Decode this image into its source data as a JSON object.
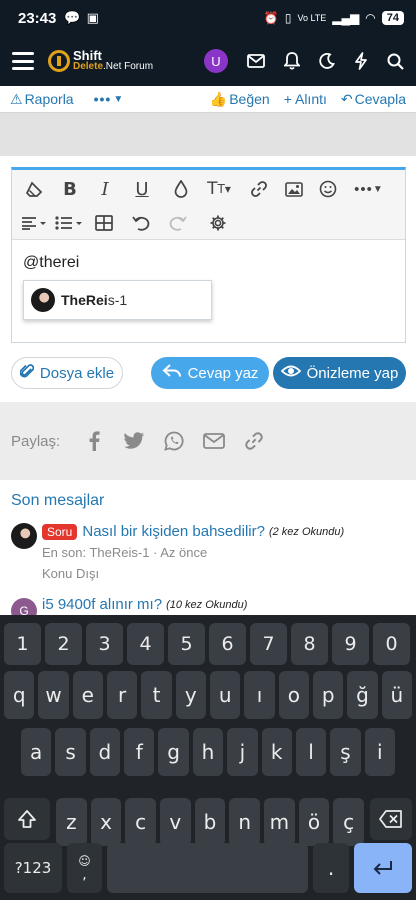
{
  "status_bar": {
    "time": "23:43",
    "battery": "74",
    "net_badge": "Vo LTE"
  },
  "app_bar": {
    "logo_line1": "Shift",
    "logo_line2a": "Delete",
    "logo_line2b": ".Net",
    "logo_line2c": " Forum",
    "avatar_letter": "U"
  },
  "post_actions": {
    "report": "Raporla",
    "more": "•••",
    "like": "Beğen",
    "quote": "+ Alıntı",
    "reply": "Cevapla"
  },
  "editor": {
    "content": "@therei",
    "mention": {
      "match": "TheRei",
      "rest": "s-1"
    }
  },
  "buttons": {
    "attach": "Dosya ekle",
    "reply": "Cevap yaz",
    "preview": "Önizleme yap"
  },
  "share": {
    "label": "Paylaş:"
  },
  "latest": {
    "title": "Son mesajlar",
    "threads": [
      {
        "badge": "Soru",
        "title": "Nasıl bir kişiden bahsedilir?",
        "count": "(2 kez Okundu)",
        "meta1": "En son: TheReis-1 · Az önce",
        "meta2": "Konu Dışı"
      },
      {
        "avatar": "G",
        "title": "i5 9400f alınır mı?",
        "count": "(10 kez Okundu)"
      }
    ]
  },
  "keyboard": {
    "row1": [
      "1",
      "2",
      "3",
      "4",
      "5",
      "6",
      "7",
      "8",
      "9",
      "0"
    ],
    "row2": [
      "q",
      "w",
      "e",
      "r",
      "t",
      "y",
      "u",
      "ı",
      "o",
      "p",
      "ğ",
      "ü"
    ],
    "row3": [
      "a",
      "s",
      "d",
      "f",
      "g",
      "h",
      "j",
      "k",
      "l",
      "ş",
      "i"
    ],
    "row4": [
      "z",
      "x",
      "c",
      "v",
      "b",
      "n",
      "m",
      "ö",
      "ç"
    ],
    "symbols": "?123",
    "comma": ",",
    "period": "."
  },
  "colors": {
    "accent": "#2577b1",
    "accent_light": "#47a7eb",
    "badge": "#e3352b",
    "header": "#0f1a24",
    "enter_key": "#8ab4f8"
  }
}
